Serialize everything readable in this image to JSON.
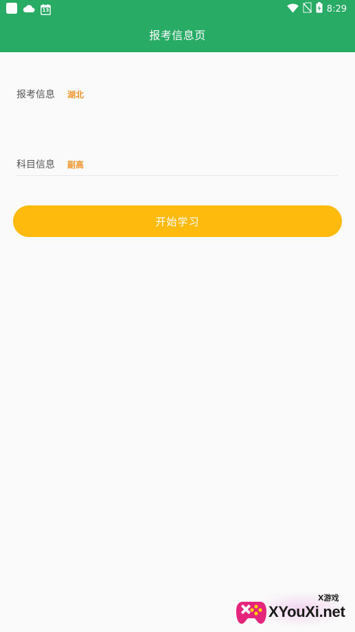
{
  "status_bar": {
    "time": "8:29",
    "calendar_day": "13",
    "left_icons": [
      "square-notification-icon",
      "cloud-icon",
      "calendar-icon"
    ],
    "right_icons": [
      "wifi-icon",
      "no-sim-icon",
      "battery-charging-icon"
    ]
  },
  "app_bar": {
    "title": "报考信息页"
  },
  "form": {
    "exam_info": {
      "label": "报考信息",
      "value": "湖北"
    },
    "subject_info": {
      "label": "科目信息",
      "value": "副高"
    }
  },
  "actions": {
    "start_label": "开始学习"
  },
  "watermark": {
    "small_text": "X游戏",
    "big_text": "XYouXi.net"
  },
  "colors": {
    "primary_green": "#27ab65",
    "accent_orange": "#f0932b",
    "button_yellow": "#ffba0e",
    "background": "#fafafa"
  }
}
